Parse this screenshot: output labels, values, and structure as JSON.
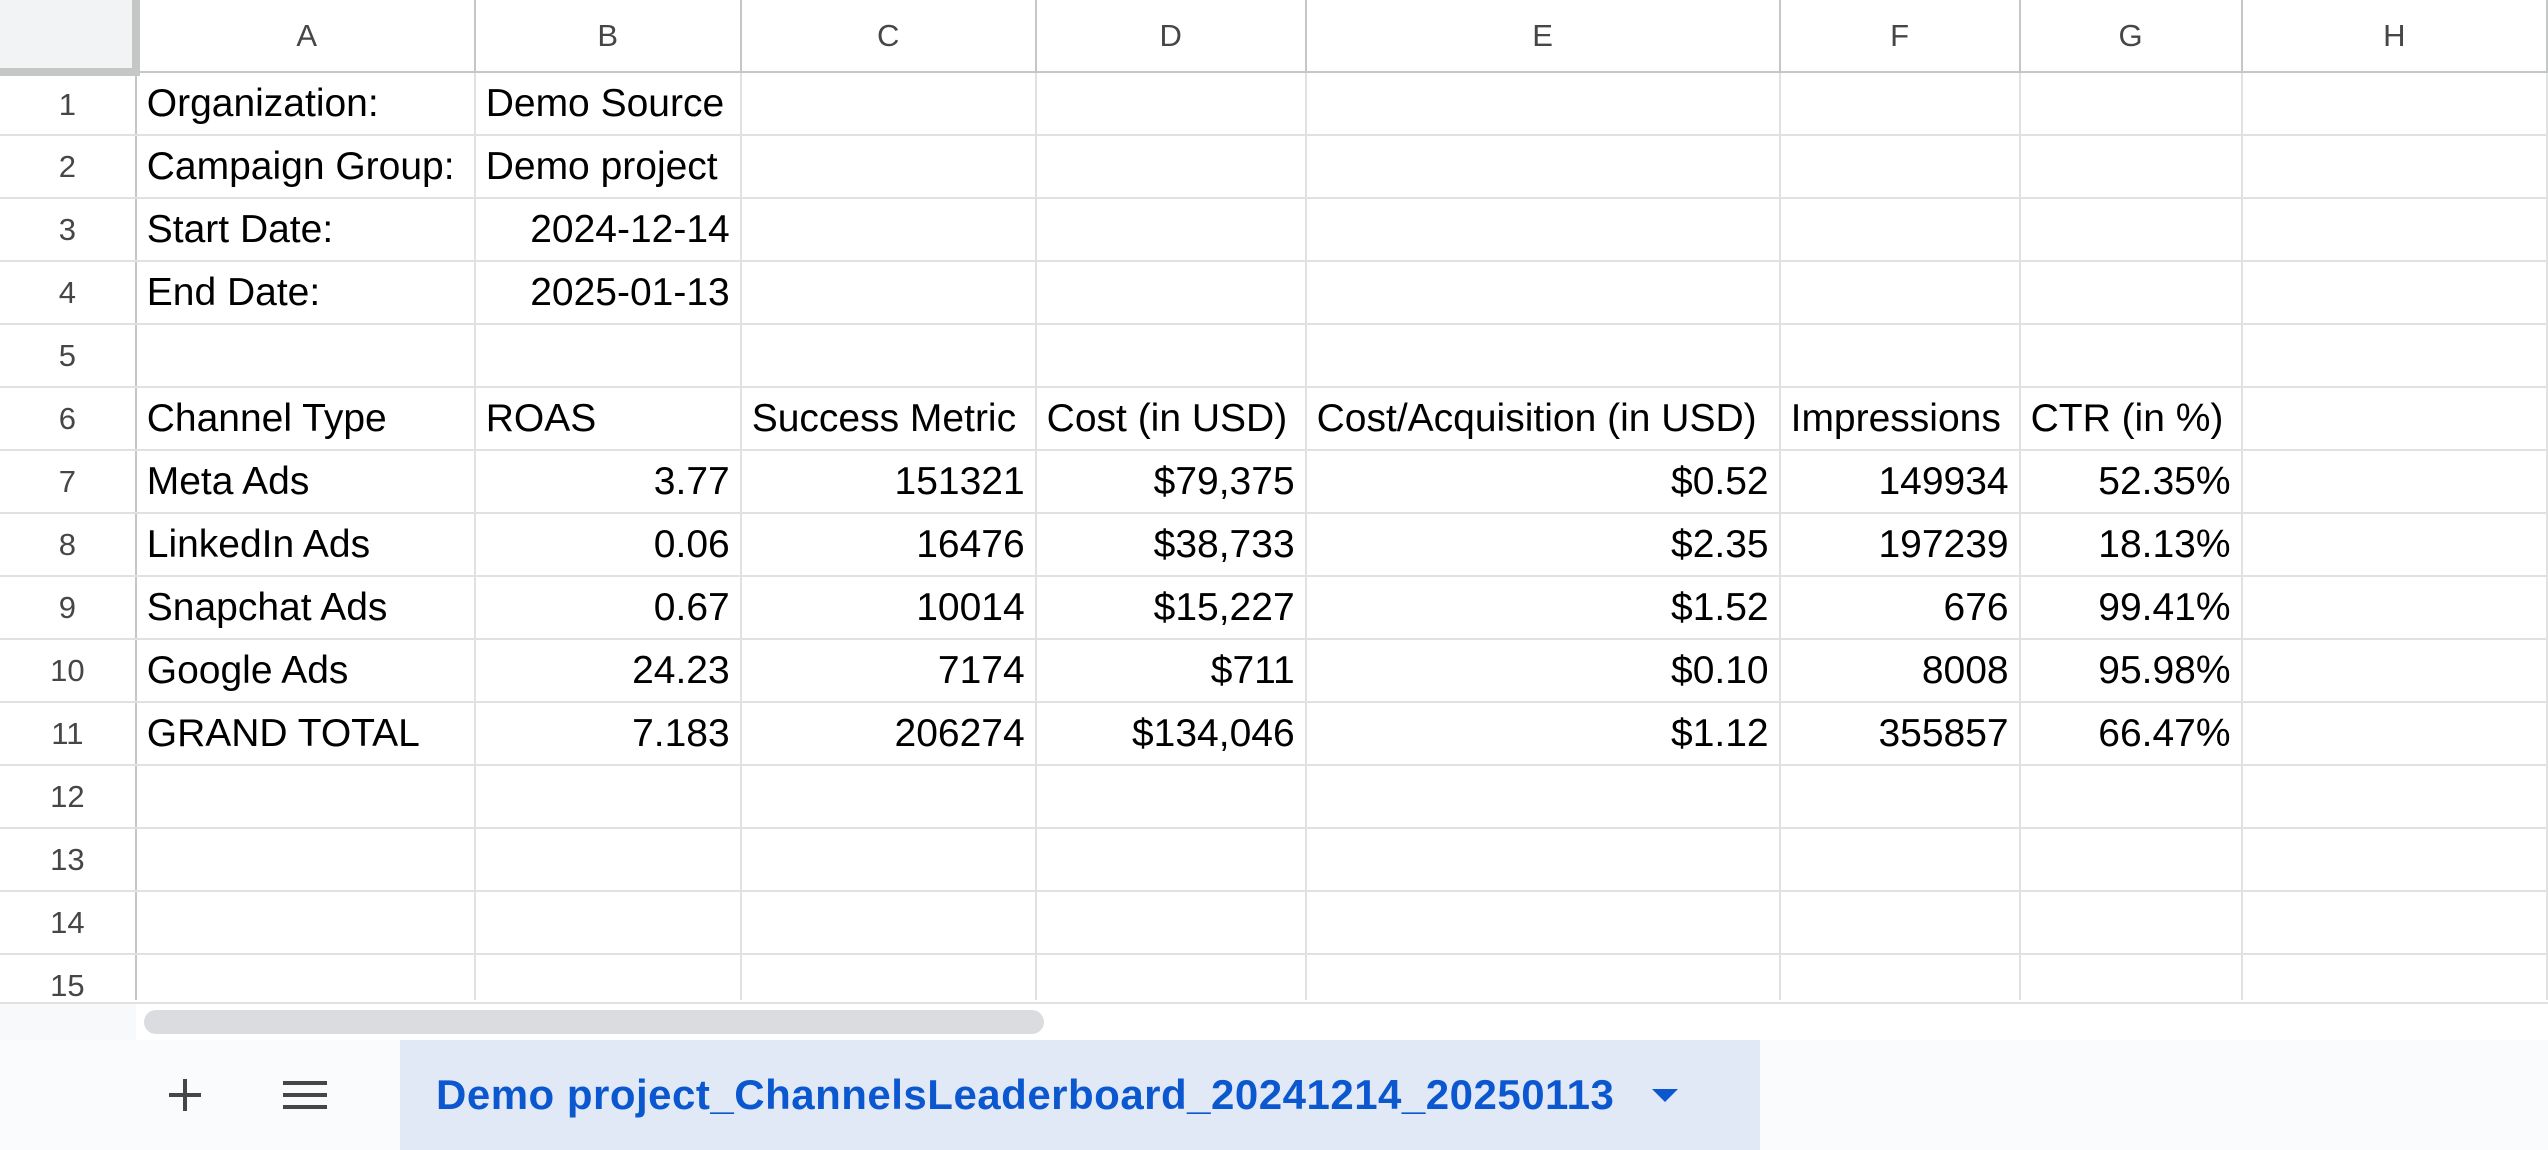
{
  "columns": [
    "A",
    "B",
    "C",
    "D",
    "E",
    "F",
    "G",
    "H"
  ],
  "rows": [
    {
      "num": "1",
      "cells": [
        "Organization:",
        "Demo Source",
        "",
        "",
        "",
        "",
        "",
        ""
      ]
    },
    {
      "num": "2",
      "cells": [
        "Campaign Group:",
        "Demo project",
        "",
        "",
        "",
        "",
        "",
        ""
      ]
    },
    {
      "num": "3",
      "cells": [
        "Start Date:",
        "2024-12-14",
        "",
        "",
        "",
        "",
        "",
        ""
      ]
    },
    {
      "num": "4",
      "cells": [
        "End Date:",
        "2025-01-13",
        "",
        "",
        "",
        "",
        "",
        ""
      ]
    },
    {
      "num": "5",
      "cells": [
        "",
        "",
        "",
        "",
        "",
        "",
        "",
        ""
      ]
    },
    {
      "num": "6",
      "cells": [
        "Channel Type",
        "ROAS",
        "Success Metric",
        "Cost (in USD)",
        "Cost/Acquisition (in USD)",
        "Impressions",
        "CTR (in %)",
        ""
      ]
    },
    {
      "num": "7",
      "cells": [
        "Meta Ads",
        "3.77",
        "151321",
        "$79,375",
        "$0.52",
        "149934",
        "52.35%",
        ""
      ]
    },
    {
      "num": "8",
      "cells": [
        "LinkedIn Ads",
        "0.06",
        "16476",
        "$38,733",
        "$2.35",
        "197239",
        "18.13%",
        ""
      ]
    },
    {
      "num": "9",
      "cells": [
        "Snapchat Ads",
        "0.67",
        "10014",
        "$15,227",
        "$1.52",
        "676",
        "99.41%",
        ""
      ]
    },
    {
      "num": "10",
      "cells": [
        "Google Ads",
        "24.23",
        "7174",
        "$711",
        "$0.10",
        "8008",
        "95.98%",
        ""
      ]
    },
    {
      "num": "11",
      "cells": [
        "GRAND TOTAL",
        "7.183",
        "206274",
        "$134,046",
        "$1.12",
        "355857",
        "66.47%",
        ""
      ]
    },
    {
      "num": "12",
      "cells": [
        "",
        "",
        "",
        "",
        "",
        "",
        "",
        ""
      ]
    },
    {
      "num": "13",
      "cells": [
        "",
        "",
        "",
        "",
        "",
        "",
        "",
        ""
      ]
    },
    {
      "num": "14",
      "cells": [
        "",
        "",
        "",
        "",
        "",
        "",
        "",
        ""
      ]
    },
    {
      "num": "15",
      "cells": [
        "",
        "",
        "",
        "",
        "",
        "",
        "",
        ""
      ]
    }
  ],
  "sheet_tab": {
    "label": "Demo project_ChannelsLeaderboard_20241214_20250113"
  },
  "icons": {
    "add_sheet": "plus-icon",
    "all_sheets": "menu-icon",
    "tab_menu": "caret-down-icon"
  },
  "colors": {
    "tab_active_bg": "#e1e9f7",
    "tab_active_text": "#0b57d0",
    "gridline": "#e1e1e1"
  }
}
